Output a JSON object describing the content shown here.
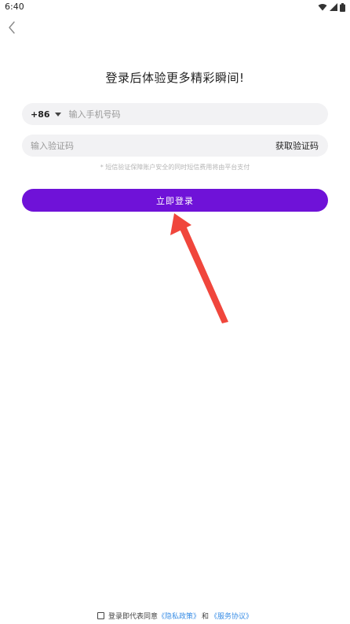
{
  "status_bar": {
    "time": "6:40",
    "icons": [
      "wifi-icon",
      "signal-icon",
      "battery-icon"
    ]
  },
  "back_icon": "chevron-left-icon",
  "headline": "登录后体验更多精彩瞬间!",
  "phone_field": {
    "country_code": "+86",
    "placeholder": "输入手机号码",
    "value": ""
  },
  "code_field": {
    "placeholder": "输入验证码",
    "value": "",
    "get_code_label": "获取验证码"
  },
  "hint_text": "* 短信验证保障账户安全的同时短信费用将由平台支付",
  "login_button": "立即登录",
  "agreement": {
    "checked": false,
    "prefix": "登录即代表同意",
    "privacy_link": "《隐私政策》",
    "and": "和",
    "service_link": "《服务协议》"
  },
  "colors": {
    "primary": "#6f12d8",
    "link": "#3a8ee6",
    "field_bg": "#f2f2f4",
    "annotation_arrow": "#f0463c"
  }
}
